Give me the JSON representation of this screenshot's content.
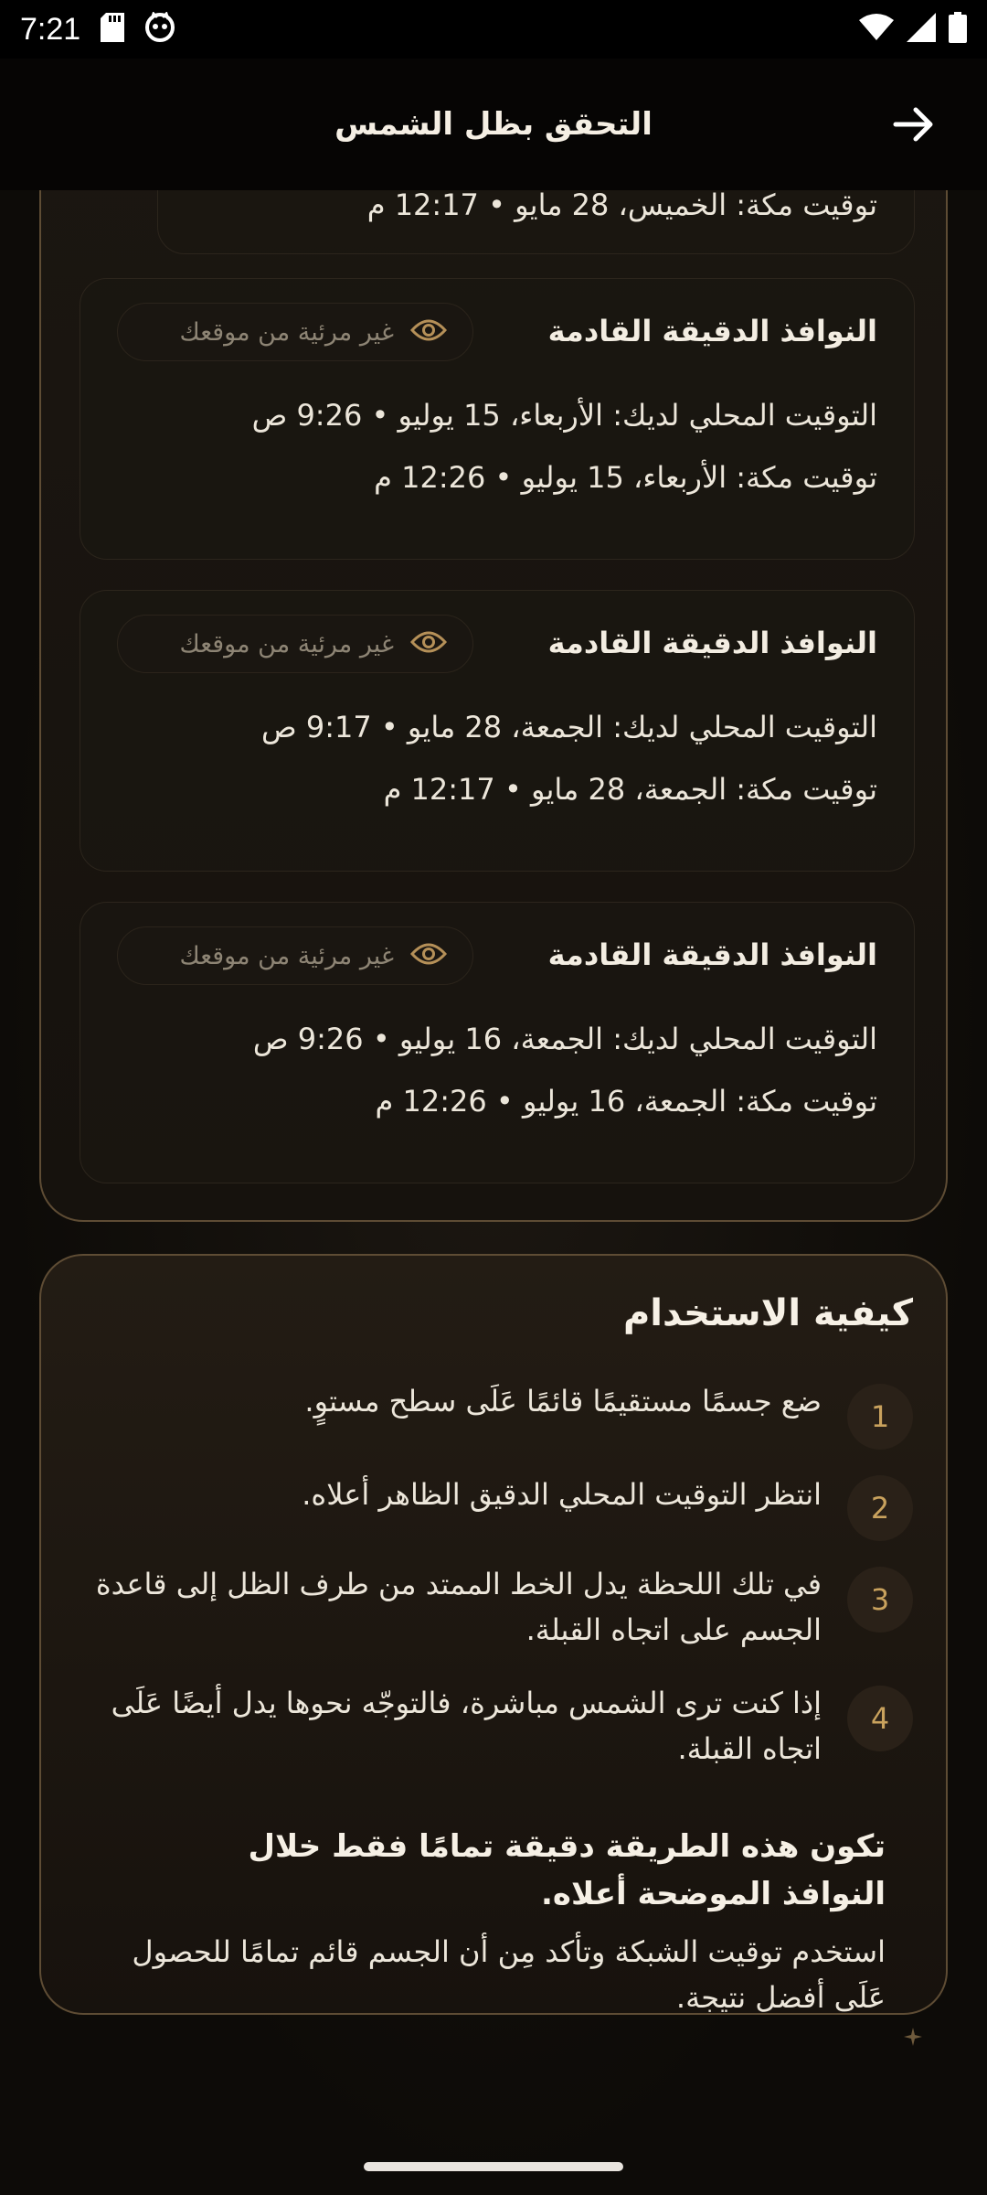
{
  "status_bar": {
    "time": "7:21"
  },
  "header": {
    "title": "التحقق بظل الشمس"
  },
  "partial_card": {
    "line": "توقيت مكة: الخميس، 28 مايو • 12:17 م"
  },
  "windows": [
    {
      "title": "النوافذ الدقيقة القادمة",
      "visibility": "غير مرئية من موقعك",
      "local": "التوقيت المحلي لديك: الأربعاء، 15 يوليو • 9:26 ص",
      "mecca": "توقيت مكة: الأربعاء، 15 يوليو • 12:26 م"
    },
    {
      "title": "النوافذ الدقيقة القادمة",
      "visibility": "غير مرئية من موقعك",
      "local": "التوقيت المحلي لديك: الجمعة، 28 مايو • 9:17 ص",
      "mecca": "توقيت مكة: الجمعة، 28 مايو • 12:17 م"
    },
    {
      "title": "النوافذ الدقيقة القادمة",
      "visibility": "غير مرئية من موقعك",
      "local": "التوقيت المحلي لديك: الجمعة، 16 يوليو • 9:26 ص",
      "mecca": "توقيت مكة: الجمعة، 16 يوليو • 12:26 م"
    }
  ],
  "howto": {
    "title": "كيفية الاستخدام",
    "steps": [
      {
        "num": "1",
        "text": "ضع جسمًا مستقيمًا قائمًا عَلَى سطح مستوٍ."
      },
      {
        "num": "2",
        "text": "انتظر التوقيت المحلي الدقيق الظاهر أعلاه."
      },
      {
        "num": "3",
        "text": "في تلك اللحظة يدل الخط الممتد من طرف الظل إلى قاعدة الجسم على اتجاه القبلة."
      },
      {
        "num": "4",
        "text": "إذا كنت ترى الشمس مباشرة، فالتوجّه نحوها يدل أيضًا عَلَى اتجاه القبلة."
      }
    ],
    "note_bold": "تكون هذه الطريقة دقيقة تمامًا فقط خلال النوافذ الموضحة أعلاه.",
    "note_text": "استخدم توقيت الشبكة وتأكد مِن أن الجسم قائم تمامًا للحصول عَلَى أفضل نتيجة."
  }
}
